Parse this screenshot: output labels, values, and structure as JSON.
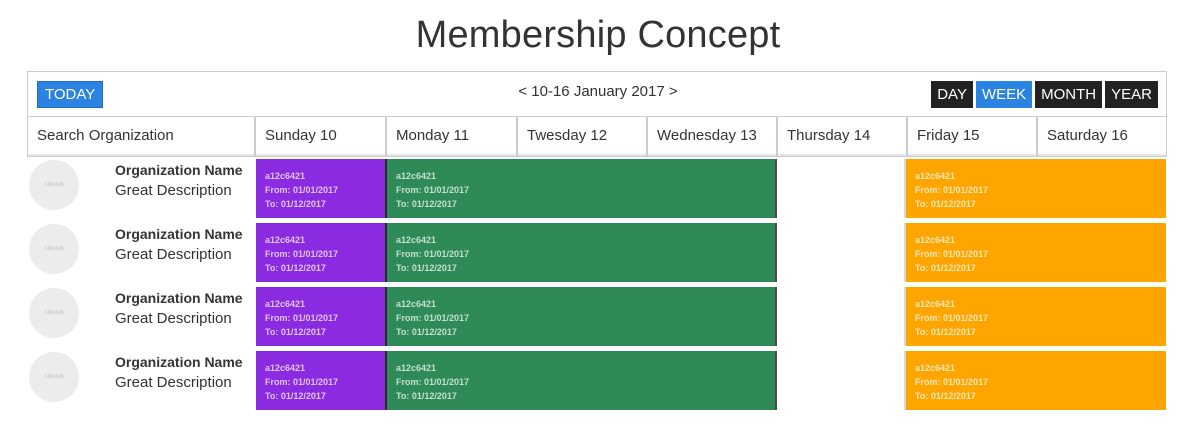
{
  "page": {
    "title": "Membership Concept"
  },
  "toolbar": {
    "today_label": "TODAY",
    "prev_label": "<",
    "range_label": "10-16 January 2017",
    "next_label": ">",
    "views": [
      {
        "label": "DAY",
        "active": false
      },
      {
        "label": "WEEK",
        "active": true
      },
      {
        "label": "MONTH",
        "active": false
      },
      {
        "label": "YEAR",
        "active": false
      }
    ]
  },
  "header": {
    "search_placeholder": "Search Organization",
    "days": [
      "Sunday 10",
      "Monday 11",
      "Twesday 12",
      "Wednesday 13",
      "Thursday 14",
      "Friday 15",
      "Saturday 16"
    ]
  },
  "colors": {
    "accent": "#2a83e0",
    "purple": "#8a2be2",
    "green": "#2e8b57",
    "orange": "#ffa500"
  },
  "rows": [
    {
      "avatar_text": "140x140",
      "name": "Organization Name",
      "description": "Great Description",
      "events": [
        {
          "id": "a12c6421",
          "from": "From: 01/01/2017",
          "to": "To: 01/12/2017"
        },
        {
          "id": "a12c6421",
          "from": "From: 01/01/2017",
          "to": "To: 01/12/2017"
        },
        {
          "id": "a12c6421",
          "from": "From: 01/01/2017",
          "to": "To: 01/12/2017"
        }
      ]
    },
    {
      "avatar_text": "140x140",
      "name": "Organization Name",
      "description": "Great Description",
      "events": [
        {
          "id": "a12c6421",
          "from": "From: 01/01/2017",
          "to": "To: 01/12/2017"
        },
        {
          "id": "a12c6421",
          "from": "From: 01/01/2017",
          "to": "To: 01/12/2017"
        },
        {
          "id": "a12c6421",
          "from": "From: 01/01/2017",
          "to": "To: 01/12/2017"
        }
      ]
    },
    {
      "avatar_text": "140x140",
      "name": "Organization Name",
      "description": "Great Description",
      "events": [
        {
          "id": "a12c6421",
          "from": "From: 01/01/2017",
          "to": "To: 01/12/2017"
        },
        {
          "id": "a12c6421",
          "from": "From: 01/01/2017",
          "to": "To: 01/12/2017"
        },
        {
          "id": "a12c6421",
          "from": "From: 01/01/2017",
          "to": "To: 01/12/2017"
        }
      ]
    },
    {
      "avatar_text": "140x140",
      "name": "Organization Name",
      "description": "Great Description",
      "events": [
        {
          "id": "a12c6421",
          "from": "From: 01/01/2017",
          "to": "To: 01/12/2017"
        },
        {
          "id": "a12c6421",
          "from": "From: 01/01/2017",
          "to": "To: 01/12/2017"
        },
        {
          "id": "a12c6421",
          "from": "From: 01/01/2017",
          "to": "To: 01/12/2017"
        }
      ]
    }
  ]
}
